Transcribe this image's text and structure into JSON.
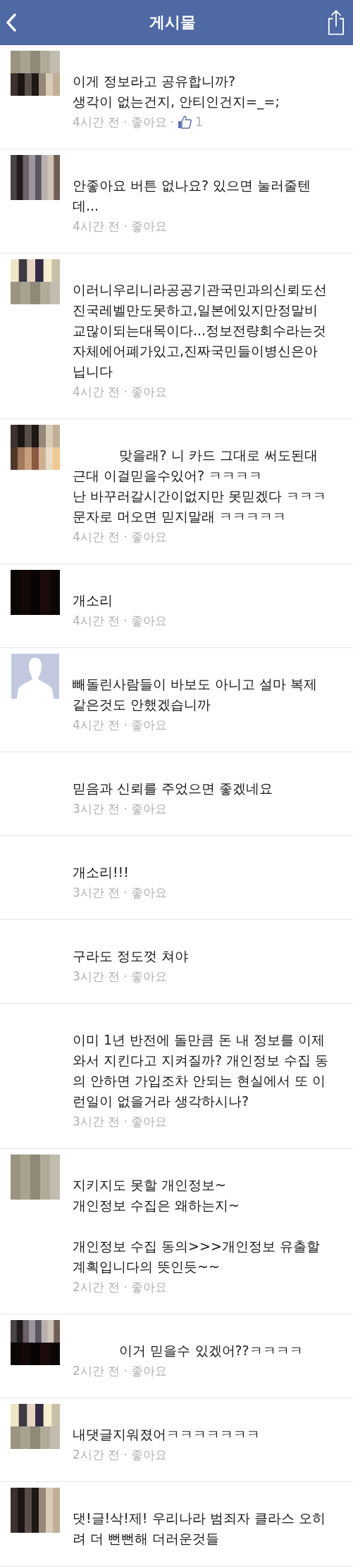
{
  "header": {
    "title": "게시물"
  },
  "comments": [
    {
      "text": "이게 정보라고 공유합니까?\n생각이 없는건지, 안티인건지=_=;",
      "meta": [
        {
          "kind": "time",
          "text": "4시간 전"
        },
        {
          "kind": "separator",
          "text": "·"
        },
        {
          "kind": "link",
          "text": "좋아요"
        },
        {
          "kind": "separator",
          "text": "·"
        },
        {
          "kind": "likes",
          "text": "1"
        }
      ]
    },
    {
      "text": "안좋아요 버튼 없나요? 있으면 눌러줄텐데...",
      "meta": [
        {
          "kind": "time",
          "text": "4시간 전"
        },
        {
          "kind": "separator",
          "text": "·"
        },
        {
          "kind": "link",
          "text": "좋아요"
        }
      ]
    },
    {
      "text": "이러니우리니라공공기관국민과의신뢰도선진국레벨만도못하고,일본에있지만정말비교많이되는대목이다...정보전량회수라는것자체에어폐가있고,진짜국민들이병신은아닙니다",
      "meta": [
        {
          "kind": "time",
          "text": "4시간 전"
        },
        {
          "kind": "separator",
          "text": "·"
        },
        {
          "kind": "link",
          "text": "좋아요"
        }
      ]
    },
    {
      "text": "           맞을래? 니 카드 그대로 써도된대근대 이걸믿을수있어? ㅋㅋㅋㅋ\n난 바꾸러갈시간이없지만 못믿겠다 ㅋㅋㅋ\n문자로 머오면 믿지말래 ㅋㅋㅋㅋㅋ",
      "meta": [
        {
          "kind": "time",
          "text": "4시간 전"
        },
        {
          "kind": "separator",
          "text": "·"
        },
        {
          "kind": "link",
          "text": "좋아요"
        }
      ]
    },
    {
      "text": "개소리",
      "meta": [
        {
          "kind": "time",
          "text": "4시간 전"
        },
        {
          "kind": "separator",
          "text": "·"
        },
        {
          "kind": "link",
          "text": "좋아요"
        }
      ]
    },
    {
      "avatar": {
        "kind": "default"
      },
      "text": "빼돌린사람들이 바보도 아니고 설마 복제같은것도 안했겠습니까",
      "meta": [
        {
          "kind": "time",
          "text": "4시간 전"
        },
        {
          "kind": "separator",
          "text": "·"
        },
        {
          "kind": "link",
          "text": "좋아요"
        }
      ]
    },
    {
      "text": "믿음과 신뢰를 주었으면 좋겠네요",
      "meta": [
        {
          "kind": "time",
          "text": "3시간 전"
        },
        {
          "kind": "separator",
          "text": "·"
        },
        {
          "kind": "link",
          "text": "좋아요"
        }
      ]
    },
    {
      "text": "개소리!!!",
      "meta": [
        {
          "kind": "time",
          "text": "3시간 전"
        },
        {
          "kind": "separator",
          "text": "·"
        },
        {
          "kind": "link",
          "text": "좋아요"
        }
      ]
    },
    {
      "text": "구라도 정도껏 쳐야",
      "meta": [
        {
          "kind": "time",
          "text": "3시간 전"
        },
        {
          "kind": "separator",
          "text": "·"
        },
        {
          "kind": "link",
          "text": "좋아요"
        }
      ]
    },
    {
      "text": "이미 1년 반전에 돌만큼 돈 내 정보를 이제와서 지킨다고 지켜질까? 개인정보 수집 동의 안하면 가입조차 안되는 현실에서 또 이런일이 없을거라 생각하시나?",
      "meta": [
        {
          "kind": "time",
          "text": "3시간 전"
        },
        {
          "kind": "separator",
          "text": "·"
        },
        {
          "kind": "link",
          "text": "좋아요"
        }
      ]
    },
    {
      "text": "지키지도 못할 개인정보~\n개인정보 수집은 왜하는지~\n\n개인정보 수집 동의>>>개인정보 유출할계획입니다의 뜻인듯~~",
      "meta": [
        {
          "kind": "time",
          "text": "2시간 전"
        },
        {
          "kind": "separator",
          "text": "·"
        },
        {
          "kind": "link",
          "text": "좋아요"
        }
      ]
    },
    {
      "text": "           이거 믿을수 있겠어??ㅋㅋㅋㅋ",
      "meta": [
        {
          "kind": "time",
          "text": "2시간 전"
        },
        {
          "kind": "separator",
          "text": "·"
        },
        {
          "kind": "link",
          "text": "좋아요"
        }
      ]
    },
    {
      "text": "내댓글지워졌어ㅋㅋㅋㅋㅋㅋㅋ",
      "meta": [
        {
          "kind": "time",
          "text": "2시간 전"
        },
        {
          "kind": "separator",
          "text": "·"
        },
        {
          "kind": "link",
          "text": "좋아요"
        }
      ]
    },
    {
      "text": "댓!글!삭!제! 우리나라 범죄자 클라스 오히려 더 뻔뻔해 더러운것들"
    }
  ]
}
